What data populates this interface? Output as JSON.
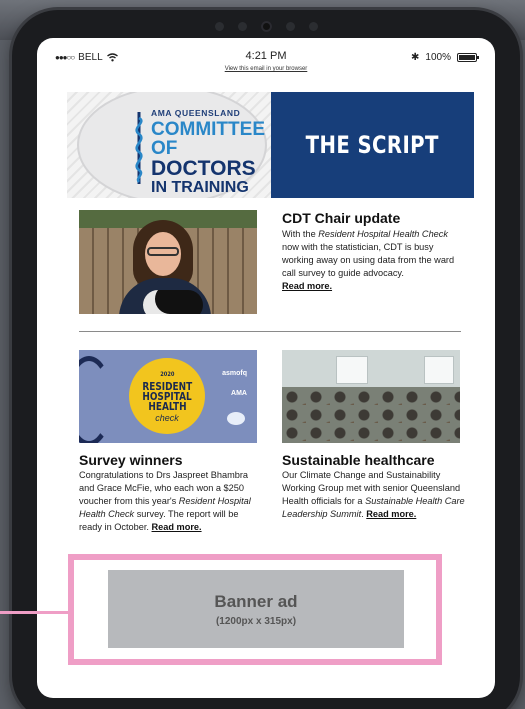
{
  "status_bar": {
    "signal": "●●●○○",
    "carrier": "BELL",
    "time": "4:21 PM",
    "web_link": "View this email in your browser",
    "bluetooth": "✱",
    "battery_percent": "100%",
    "battery_level": 1.0
  },
  "header": {
    "org_small": "AMA QUEENSLAND",
    "org_line1": "COMMITTEE OF",
    "org_line2": "DOCTORS",
    "org_line3": "IN TRAINING",
    "newsletter_title": "THE SCRIPT",
    "colors": {
      "navy": "#173e7a",
      "light_blue": "#2a87c8"
    }
  },
  "articles": [
    {
      "title": "CDT Chair update",
      "body_pre": "With the ",
      "body_italic": "Resident Hospital Health Check",
      "body_post": " now with the statistician, CDT is busy working away on using data from the ward call survey to guide advocacy.",
      "read_more": "Read more."
    },
    {
      "title": "Survey winners",
      "body_pre": "Congratulations to Drs Jaspreet Bhambra and Grace McFie, who each won a $250 voucher from this year's ",
      "body_italic": "Resident Hospital Health Check",
      "body_post": " survey. The report will be ready in October. ",
      "read_more": "Read more."
    },
    {
      "title": "Sustainable healthcare",
      "body_pre": "Our Climate Change and Sustainability Working Group met with senior Queensland Health officials for a ",
      "body_italic": "Sustainable Health Care Leadership Summit",
      "body_post": ". ",
      "read_more": "Read more."
    }
  ],
  "survey_image": {
    "year": "2020",
    "line1": "RESIDENT",
    "line2": "HOSPITAL",
    "line3": "HEALTH",
    "script": "check",
    "logo1": "asmofq",
    "logo2": "AMA"
  },
  "banner_ad": {
    "title": "Banner ad",
    "size": "(1200px x 315px)",
    "border_color": "#ef9ec6"
  }
}
